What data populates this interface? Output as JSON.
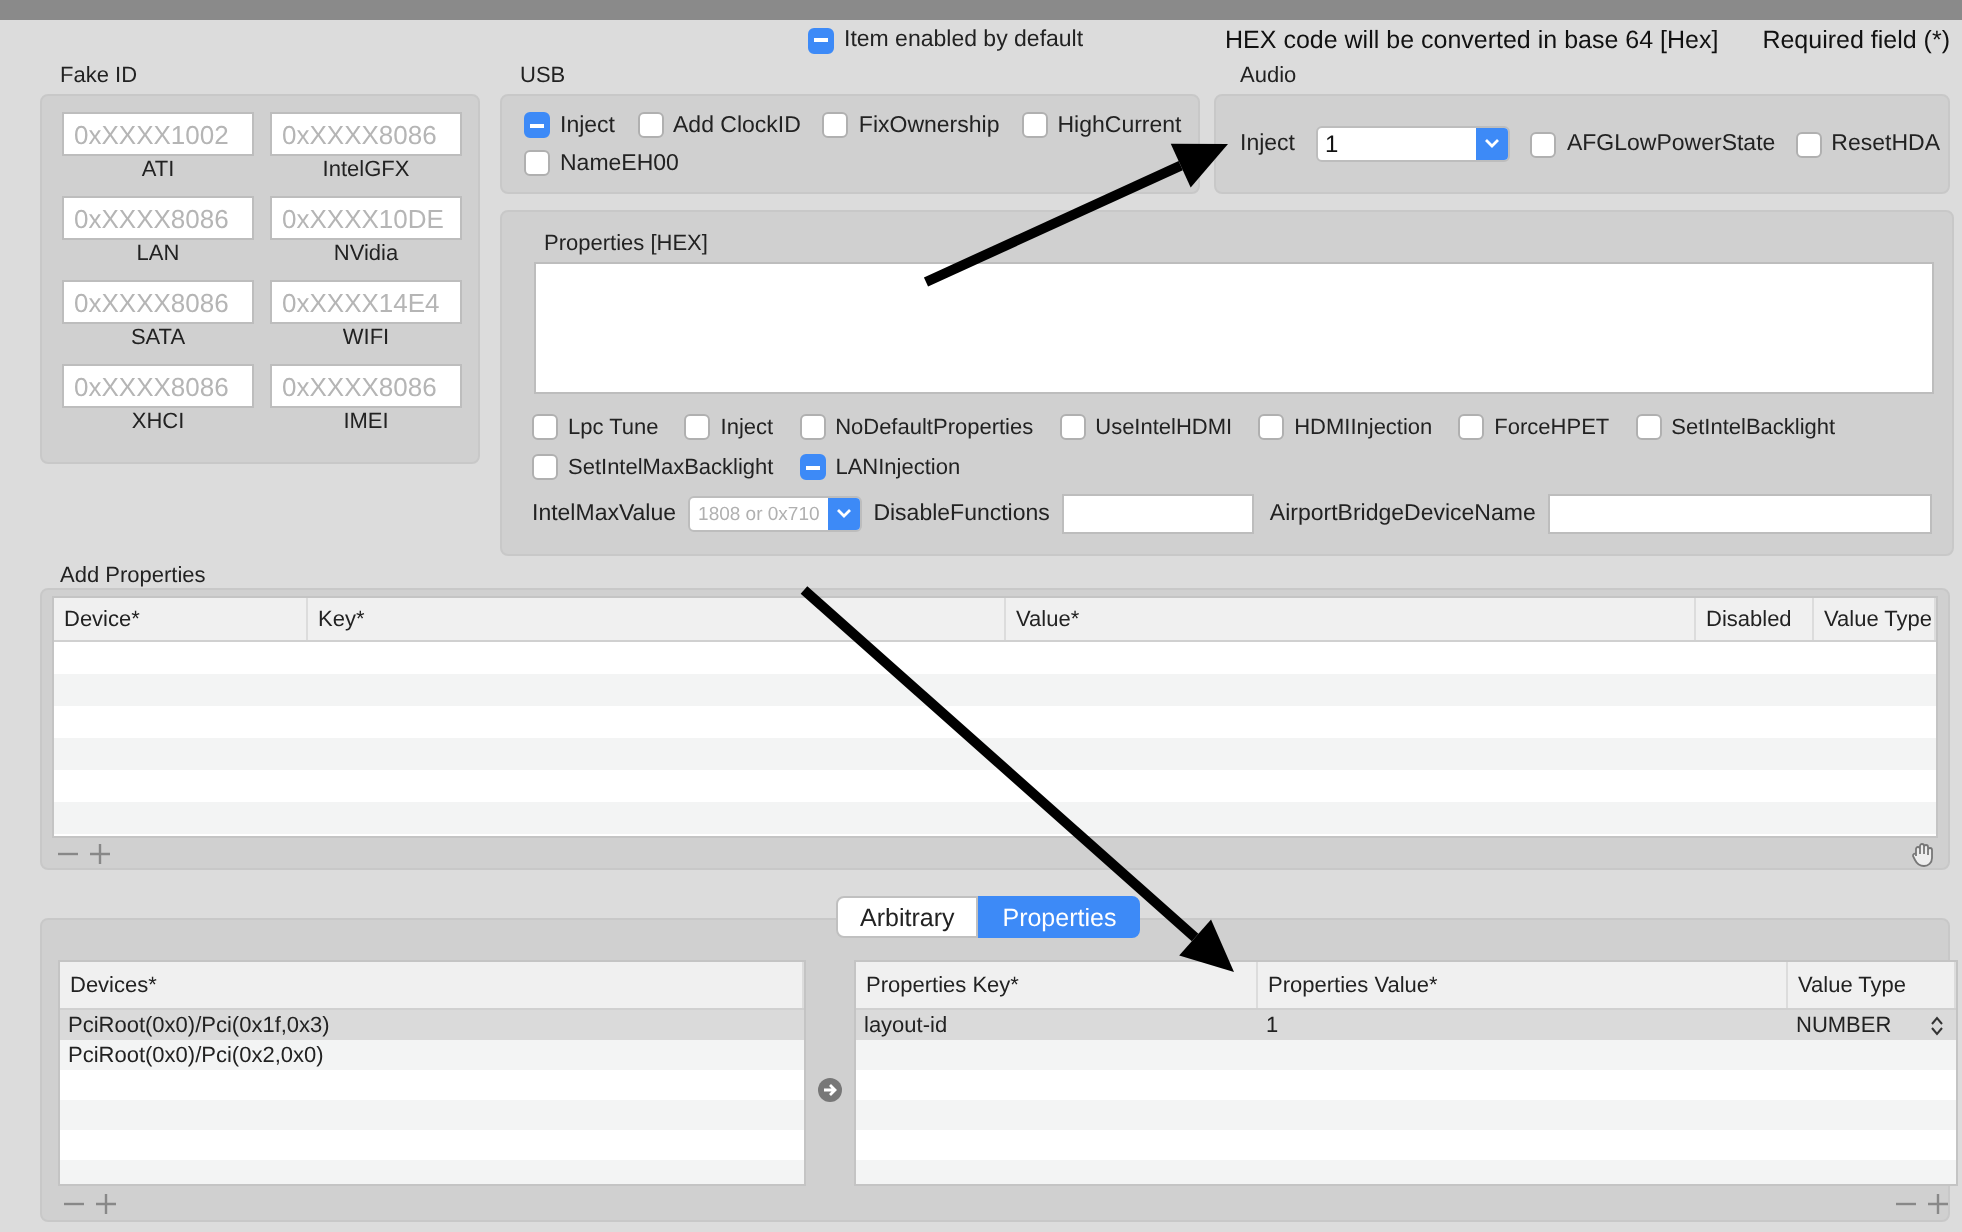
{
  "header": {
    "enabled_by_default": {
      "label": "Item enabled by default",
      "checked": true
    },
    "notes": [
      "HEX code will be converted in base 64 [Hex]",
      "Required field (*)"
    ]
  },
  "fake_id": {
    "title": "Fake ID",
    "fields": [
      {
        "placeholder": "0xXXXX1002",
        "label": "ATI"
      },
      {
        "placeholder": "0xXXXX8086",
        "label": "IntelGFX"
      },
      {
        "placeholder": "0xXXXX8086",
        "label": "LAN"
      },
      {
        "placeholder": "0xXXXX10DE",
        "label": "NVidia"
      },
      {
        "placeholder": "0xXXXX8086",
        "label": "SATA"
      },
      {
        "placeholder": "0xXXXX14E4",
        "label": "WIFI"
      },
      {
        "placeholder": "0xXXXX8086",
        "label": "XHCI"
      },
      {
        "placeholder": "0xXXXX8086",
        "label": "IMEI"
      }
    ]
  },
  "usb": {
    "title": "USB",
    "options": [
      {
        "label": "Inject",
        "checked": true
      },
      {
        "label": "Add ClockID",
        "checked": false
      },
      {
        "label": "FixOwnership",
        "checked": false
      },
      {
        "label": "HighCurrent",
        "checked": false
      },
      {
        "label": "NameEH00",
        "checked": false
      }
    ]
  },
  "audio": {
    "title": "Audio",
    "inject_label": "Inject",
    "inject_value": "1",
    "options": [
      {
        "label": "AFGLowPowerState",
        "checked": false
      },
      {
        "label": "ResetHDA",
        "checked": false
      }
    ]
  },
  "properties": {
    "title": "Properties [HEX]",
    "options": [
      {
        "label": "Lpc Tune",
        "checked": false
      },
      {
        "label": "Inject",
        "checked": false
      },
      {
        "label": "NoDefaultProperties",
        "checked": false
      },
      {
        "label": "UseIntelHDMI",
        "checked": false
      },
      {
        "label": "HDMIInjection",
        "checked": false
      },
      {
        "label": "ForceHPET",
        "checked": false
      },
      {
        "label": "SetIntelBacklight",
        "checked": false
      },
      {
        "label": "SetIntelMaxBacklight",
        "checked": false
      },
      {
        "label": "LANInjection",
        "checked": true
      }
    ],
    "intel_max_value": {
      "label": "IntelMaxValue",
      "placeholder": "1808 or 0x710"
    },
    "disable_functions": {
      "label": "DisableFunctions"
    },
    "airport_bridge": {
      "label": "AirportBridgeDeviceName"
    }
  },
  "add_properties": {
    "title": "Add Properties",
    "columns": [
      "Device*",
      "Key*",
      "Value*",
      "Disabled",
      "Value Type"
    ]
  },
  "tabs": [
    {
      "label": "Arbitrary",
      "selected": false
    },
    {
      "label": "Properties",
      "selected": true
    }
  ],
  "devices": {
    "columns": [
      "Devices*"
    ],
    "rows": [
      {
        "path": "PciRoot(0x0)/Pci(0x1f,0x3)",
        "selected": true
      },
      {
        "path": "PciRoot(0x0)/Pci(0x2,0x0)",
        "selected": false
      }
    ]
  },
  "device_properties": {
    "columns": [
      "Properties Key*",
      "Properties Value*",
      "Value Type"
    ],
    "rows": [
      {
        "key": "layout-id",
        "value": "1",
        "type": "NUMBER",
        "selected": true
      }
    ]
  }
}
